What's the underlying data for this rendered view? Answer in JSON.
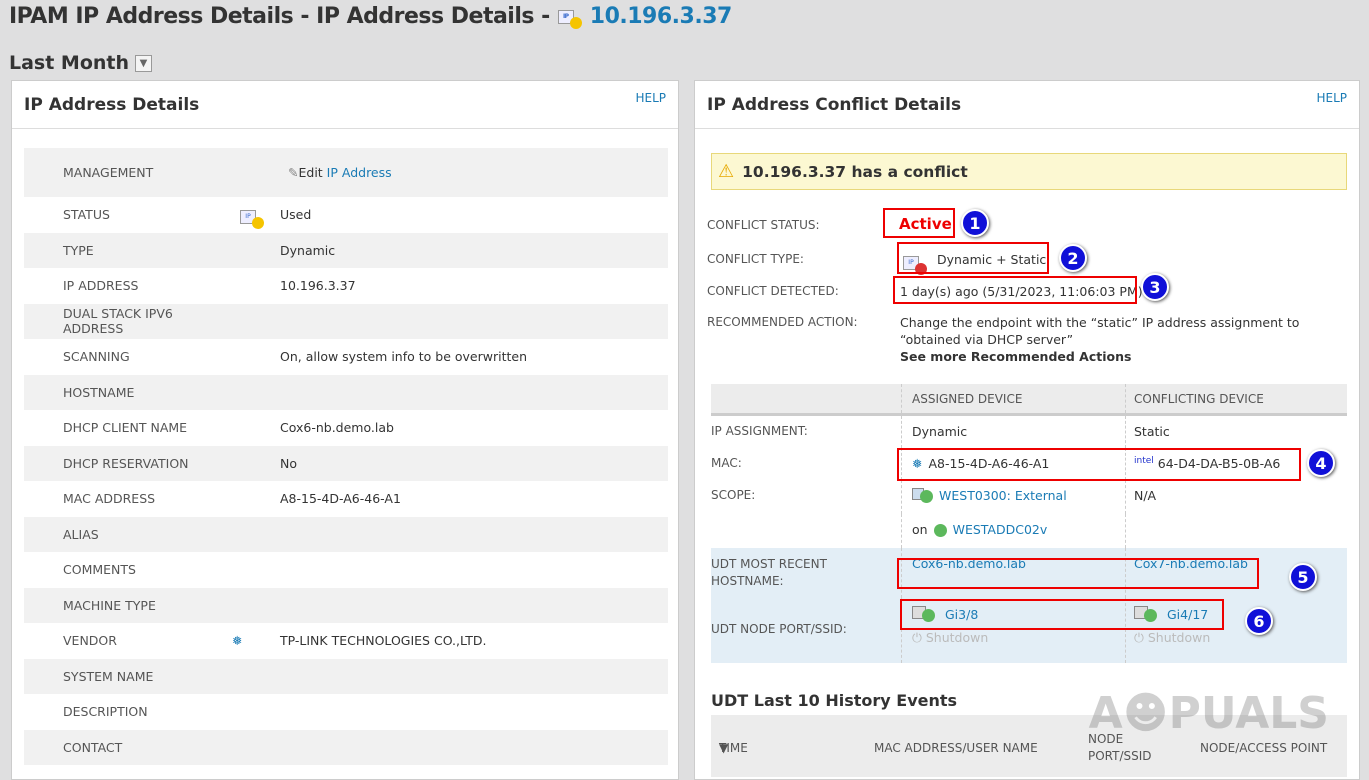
{
  "page": {
    "title": "IPAM IP Address Details - IP Address Details -",
    "ip": "10.196.3.37",
    "period": "Last Month"
  },
  "left": {
    "title": "IP Address Details",
    "help": "HELP",
    "rows": [
      {
        "k": "MANAGEMENT",
        "v": "Edit ",
        "link": "IP Address",
        "icon": "pencil-icon"
      },
      {
        "k": "STATUS",
        "v": "Used",
        "icon": "ip-used-icon"
      },
      {
        "k": "TYPE",
        "v": "Dynamic"
      },
      {
        "k": "IP ADDRESS",
        "v": "10.196.3.37"
      },
      {
        "k": "DUAL STACK IPV6 ADDRESS",
        "v": ""
      },
      {
        "k": "SCANNING",
        "v": "On, allow system info to be overwritten"
      },
      {
        "k": "HOSTNAME",
        "v": ""
      },
      {
        "k": "DHCP CLIENT NAME",
        "v": "Cox6-nb.demo.lab"
      },
      {
        "k": "DHCP RESERVATION",
        "v": "No"
      },
      {
        "k": "MAC ADDRESS",
        "v": "A8-15-4D-A6-46-A1"
      },
      {
        "k": "ALIAS",
        "v": ""
      },
      {
        "k": "COMMENTS",
        "v": ""
      },
      {
        "k": "MACHINE TYPE",
        "v": ""
      },
      {
        "k": "VENDOR",
        "v": "TP-LINK TECHNOLOGIES CO.,LTD.",
        "icon": "tplink-icon"
      },
      {
        "k": "SYSTEM NAME",
        "v": ""
      },
      {
        "k": "DESCRIPTION",
        "v": ""
      },
      {
        "k": "CONTACT",
        "v": ""
      }
    ]
  },
  "right": {
    "title": "IP Address Conflict Details",
    "help": "HELP",
    "alert": "10.196.3.37 has a conflict",
    "status_label": "CONFLICT STATUS:",
    "status": "Active",
    "type_label": "CONFLICT TYPE:",
    "type": "Dynamic + Static",
    "detected_label": "CONFLICT DETECTED:",
    "detected": "1 day(s) ago (5/31/2023, 11:06:03 PM)",
    "action_label": "RECOMMENDED ACTION:",
    "action": "Change the endpoint with the “static” IP address assignment to “obtained via DHCP server”",
    "action_link": "See more Recommended Actions",
    "grid": {
      "h_assigned": "ASSIGNED DEVICE",
      "h_conflicting": "CONFLICTING DEVICE",
      "ipa_label": "IP ASSIGNMENT:",
      "ipa_a": "Dynamic",
      "ipa_c": "Static",
      "mac_label": "MAC:",
      "mac_a": "A8-15-4D-A6-46-A1",
      "mac_c": "64-D4-DA-B5-0B-A6",
      "intel": "intel",
      "scope_label": "SCOPE:",
      "scope_a": "WEST0300: External",
      "scope_c": "N/A",
      "on": "on",
      "server": "WESTADDC02v",
      "host_label": "UDT MOST RECENT HOSTNAME:",
      "host_a": "Cox6-nb.demo.lab",
      "host_c": "Cox7-nb.demo.lab",
      "port_label": "UDT NODE PORT/SSID:",
      "port_a": "Gi3/8",
      "port_c": "Gi4/17",
      "shutdown": "Shutdown"
    },
    "history": {
      "title": "UDT Last 10 History Events",
      "cols": [
        "TIME",
        "MAC ADDRESS/USER NAME",
        "NODE PORT/SSID",
        "NODE/ACCESS POINT"
      ]
    }
  },
  "badges": [
    "1",
    "2",
    "3",
    "4",
    "5",
    "6"
  ],
  "watermark": "APPUALS",
  "colors": {
    "link": "#1a7bb5",
    "active": "#e00000",
    "highlight": "#e00000",
    "badge": "#1010d8"
  }
}
